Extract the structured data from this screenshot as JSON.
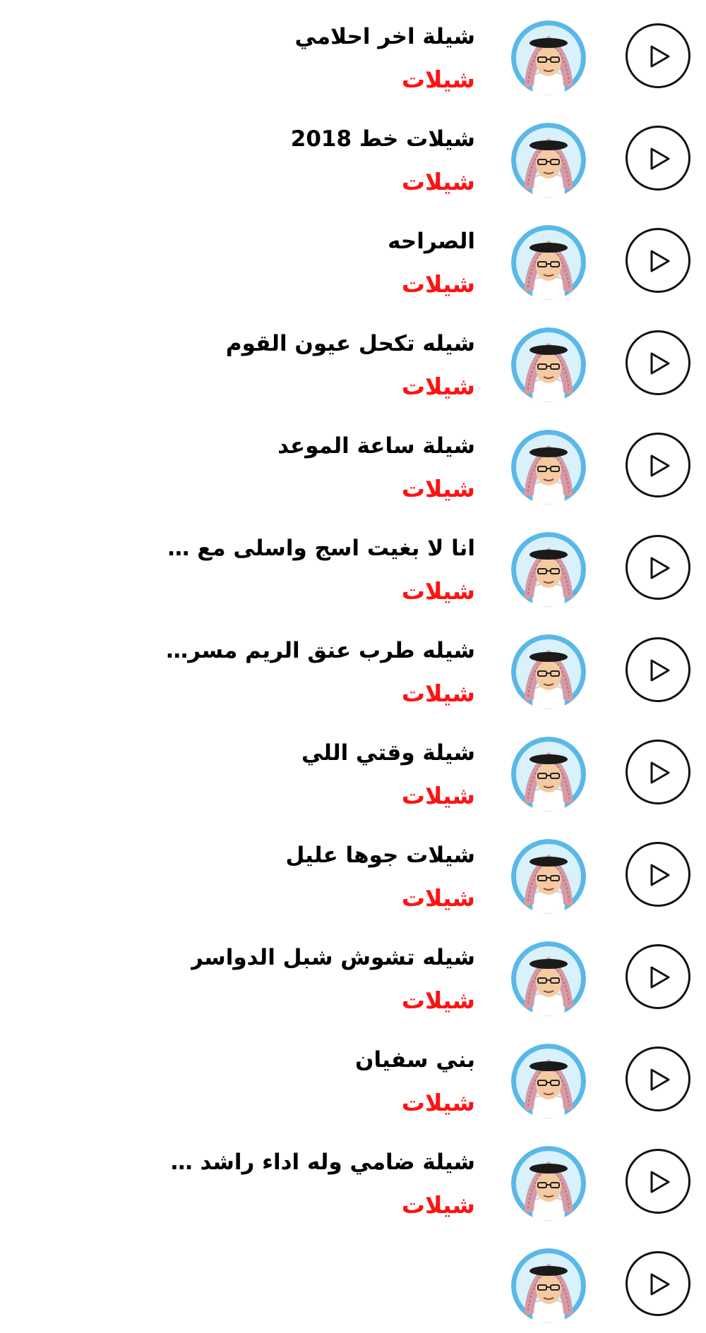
{
  "colors": {
    "title": "#000000",
    "subtitle": "#ff1212",
    "play_border": "#111111",
    "avatar_ring": "#5ab8e8"
  },
  "icons": {
    "play": "play-icon",
    "avatar": "avatar-icon"
  },
  "songs": [
    {
      "title": "شيلة اخر احلامي",
      "subtitle": "شيلات"
    },
    {
      "title": "شيلات خط 2018",
      "subtitle": "شيلات"
    },
    {
      "title": "الصراحه",
      "subtitle": "شيلات"
    },
    {
      "title": "شيله تكحل عيون القوم",
      "subtitle": "شيلات"
    },
    {
      "title": "شيلة  ساعة الموعد",
      "subtitle": "شيلات"
    },
    {
      "title": "انا لا بغيت اسج واسلى مع ال...",
      "subtitle": "شيلات"
    },
    {
      "title": "شيله طرب  عنق الريم  مسرعه",
      "subtitle": "شيلات"
    },
    {
      "title": "شيلة وقتي اللي",
      "subtitle": "شيلات"
    },
    {
      "title": "شيلات جوها عليل",
      "subtitle": "شيلات"
    },
    {
      "title": "شيله تشوش  شبل الدواسر",
      "subtitle": "شيلات"
    },
    {
      "title": "بني سفيان",
      "subtitle": "شيلات"
    },
    {
      "title": "شيلة ضامي وله اداء راشد آ...",
      "subtitle": "شيلات"
    },
    {
      "title": "",
      "subtitle": ""
    }
  ]
}
